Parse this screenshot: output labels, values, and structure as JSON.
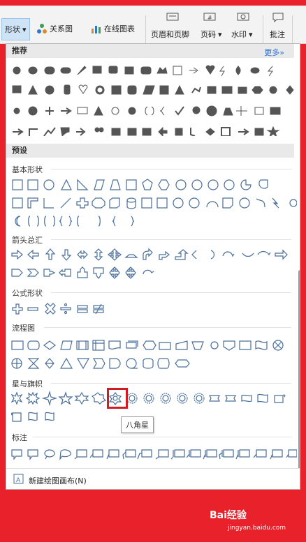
{
  "ribbon": {
    "shape_btn": "形状",
    "relation_btn": "关系图",
    "online_chart_btn": "在线图表",
    "header_footer_btn": "页眉和页脚",
    "page_num_btn": "页码",
    "watermark_btn": "水印",
    "comment_btn": "批注",
    "dropdown_glyph": "▾"
  },
  "panel": {
    "recommended_title": "推荐",
    "more_link": "更多»",
    "preset_title": "预设",
    "categories": {
      "basic": "基本形状",
      "arrows": "箭头总汇",
      "formula": "公式形状",
      "flowchart": "流程图",
      "stars": "星与旗帜",
      "callouts": "标注"
    },
    "tooltip": "八角星",
    "footer_label": "新建绘图画布(N)"
  },
  "watermark": {
    "brand": "Bai经验",
    "url": "jingyan.baidu.com"
  },
  "colors": {
    "frame_red": "#e8212a",
    "highlight_red": "#d01c24",
    "icon_gray": "#555555",
    "outline_blue": "#4a6f9a",
    "link_blue": "#2a6fd6"
  }
}
